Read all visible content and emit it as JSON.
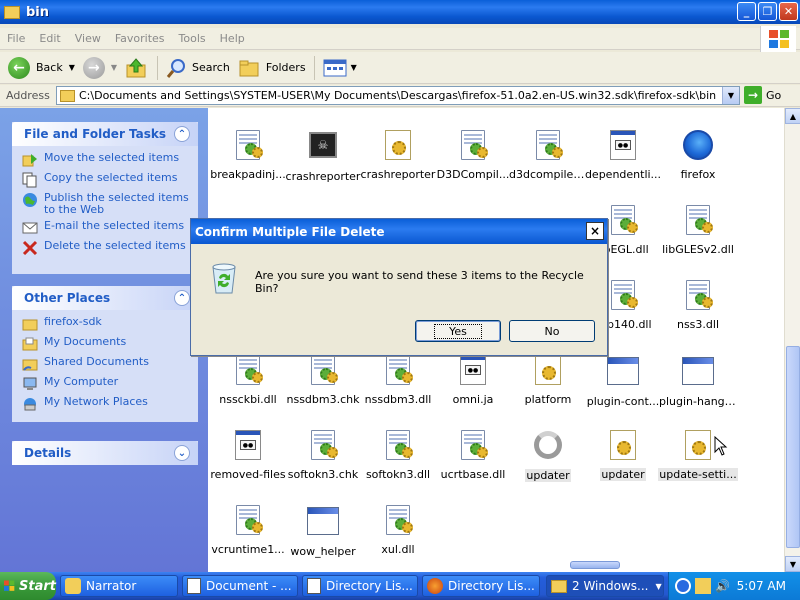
{
  "window": {
    "title": "bin"
  },
  "menu": [
    "File",
    "Edit",
    "View",
    "Favorites",
    "Tools",
    "Help"
  ],
  "toolbar": {
    "back": "Back",
    "search": "Search",
    "folders": "Folders"
  },
  "address": {
    "label": "Address",
    "path": "C:\\Documents and Settings\\SYSTEM-USER\\My Documents\\Descargas\\firefox-51.0a2.en-US.win32.sdk\\firefox-sdk\\bin",
    "go": "Go"
  },
  "tasks": {
    "title": "File and Folder Tasks",
    "items": [
      "Move the selected items",
      "Copy the selected items",
      "Publish the selected items to the Web",
      "E-mail the selected items",
      "Delete the selected items"
    ]
  },
  "places": {
    "title": "Other Places",
    "items": [
      "firefox-sdk",
      "My Documents",
      "Shared Documents",
      "My Computer",
      "My Network Places"
    ]
  },
  "details": {
    "title": "Details"
  },
  "files": [
    "breakpadinj...",
    "crashreporter",
    "crashreporter",
    "D3DCompil...",
    "d3dcompiler...",
    "dependentli...",
    "firefox",
    "libEGL.dll",
    "libGLESv2.dll",
    "vcp140.dll",
    "nss3.dll",
    "nssckbi.dll",
    "nssdbm3.chk",
    "nssdbm3.dll",
    "omni.ja",
    "platform",
    "plugin-cont...",
    "plugin-hang-ui",
    "removed-files",
    "softokn3.chk",
    "softokn3.dll",
    "ucrtbase.dll",
    "updater",
    "updater",
    "update-setti...",
    "vcruntime1...",
    "wow_helper",
    "xul.dll"
  ],
  "dialog": {
    "title": "Confirm Multiple File Delete",
    "message": "Are you sure you want to send these 3 items to the Recycle Bin?",
    "yes": "Yes",
    "no": "No",
    "close": "×"
  },
  "taskbar": {
    "start": "Start",
    "tasks": [
      "Narrator",
      "Document - ...",
      "Directory Lis...",
      "Directory Lis...",
      "2 Windows..."
    ],
    "time": "5:07 AM"
  }
}
